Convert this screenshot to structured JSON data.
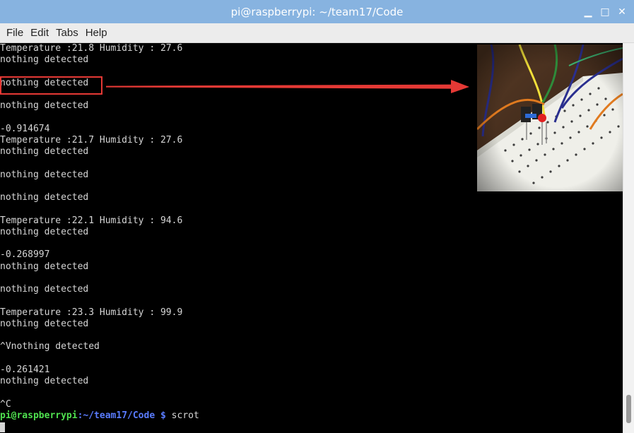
{
  "window": {
    "title": "pi@raspberrypi: ~/team17/Code",
    "controls": {
      "minimize": "▁",
      "maximize": "□",
      "close": "✕"
    }
  },
  "menu": {
    "items": [
      "File",
      "Edit",
      "Tabs",
      "Help"
    ]
  },
  "terminal": {
    "lines": [
      "Temperature :21.8 Humidity : 27.6",
      "nothing detected",
      "",
      "nothing detected",
      "",
      "nothing detected",
      "",
      "-0.914674",
      "Temperature :21.7 Humidity : 27.6",
      "nothing detected",
      "",
      "nothing detected",
      "",
      "nothing detected",
      "",
      "Temperature :22.1 Humidity : 94.6",
      "nothing detected",
      "",
      "-0.268997",
      "nothing detected",
      "",
      "nothing detected",
      "",
      "Temperature :23.3 Humidity : 99.9",
      "nothing detected",
      "",
      "^Vnothing detected",
      "",
      "-0.261421",
      "nothing detected",
      "",
      "^C"
    ],
    "prompt": {
      "user": "pi@raspberrypi",
      "path": ":~/team17/Code $",
      "command": " scrot"
    }
  },
  "annotation": {
    "color": "#e53935"
  },
  "colors": {
    "titlebar": "#87b3e0",
    "terminal_bg": "#000000",
    "prompt_user": "#4fe04f",
    "prompt_path": "#5a7cff"
  }
}
